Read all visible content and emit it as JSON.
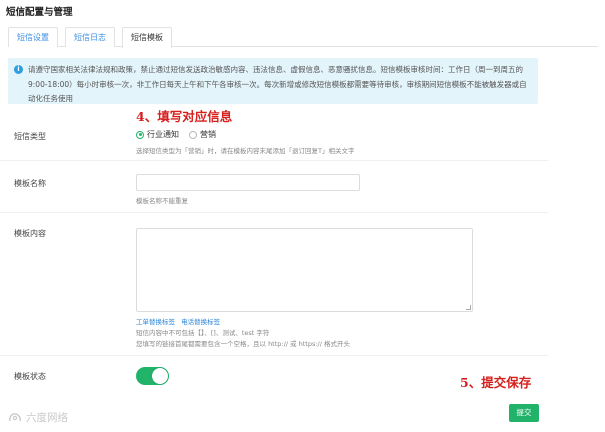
{
  "header": {
    "title": "短信配置与管理"
  },
  "tabs": [
    {
      "label": "短信设置"
    },
    {
      "label": "短信日志"
    },
    {
      "label": "短信模板"
    }
  ],
  "notice": {
    "icon": "info-icon",
    "text": "请遵守国家相关法律法规和政策，禁止通过短信发送政治敏感内容、违法信息、虚假信息、恶意骚扰信息。短信模板审核时间：工作日（周一到周五的 9:00-18:00）每小时审核一次，非工作日每天上午和下午各审核一次。每次新增或修改短信模板都需要等待审核，审核期间短信模板不能被触发器或自动化任务使用"
  },
  "annotations": {
    "step4": "4、填写对应信息",
    "step5": "5、提交保存"
  },
  "form": {
    "sms_type": {
      "label": "短信类型",
      "options": [
        {
          "label": "行业通知",
          "checked": true
        },
        {
          "label": "营销",
          "checked": false
        }
      ],
      "hint": "选择短信类型为「营销」时，请在模板内容末尾添加「退订回复T」相关文字"
    },
    "template_name": {
      "label": "模板名称",
      "value": "",
      "hint": "模板名称不能重复"
    },
    "template_content": {
      "label": "模板内容",
      "value": "",
      "links": [
        "工单替换标签",
        "电话替换标签"
      ],
      "hint1": "短信内容中不可包括【】、[]、测试、test 字符",
      "hint2": "您填写的链接首尾都需要包含一个空格，且以 http:// 或 https:// 格式开头"
    },
    "template_status": {
      "label": "模板状态",
      "enabled": true
    },
    "submit_label": "提交"
  },
  "watermark": {
    "text": "六度网络"
  },
  "colors": {
    "accent": "#21b36a",
    "link": "#2a86d6",
    "notice_bg": "#e3f4fb",
    "annotation": "#d6201d"
  }
}
